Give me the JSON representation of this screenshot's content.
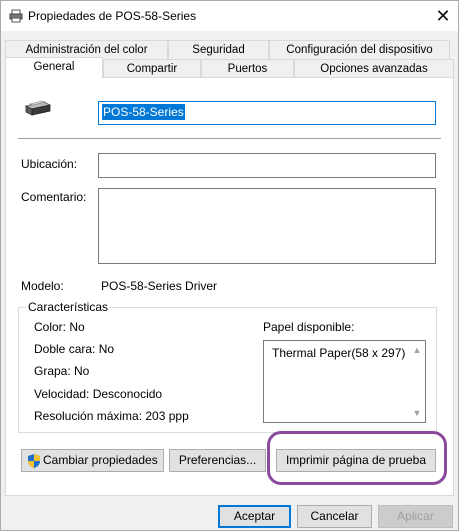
{
  "window": {
    "title": "Propiedades de POS-58-Series",
    "close_glyph": "✕"
  },
  "tabs": {
    "row_top": [
      "Administración del color",
      "Seguridad",
      "Configuración del dispositivo"
    ],
    "row_bottom": [
      "General",
      "Compartir",
      "Puertos",
      "Opciones avanzadas"
    ],
    "active": "General"
  },
  "general": {
    "printer_name": "POS-58-Series",
    "location_label": "Ubicación:",
    "location_value": "",
    "comment_label": "Comentario:",
    "comment_value": "",
    "model_label": "Modelo:",
    "model_value": "POS-58-Series Driver"
  },
  "features": {
    "group_label": "Características",
    "color": "Color: No",
    "duplex": "Doble cara: No",
    "staple": "Grapa: No",
    "speed": "Velocidad: Desconocido",
    "resolution": "Resolución máxima: 203 ppp",
    "paper_label": "Papel disponible:",
    "paper_items": [
      "Thermal Paper(58 x 297)"
    ]
  },
  "actions": {
    "change_properties": "Cambiar propiedades",
    "preferences": "Preferencias...",
    "print_test": "Imprimir página de prueba"
  },
  "footer": {
    "ok": "Aceptar",
    "cancel": "Cancelar",
    "apply": "Aplicar"
  },
  "colors": {
    "accent": "#0078d7",
    "highlight_ring": "#8b4a9c"
  },
  "icons": [
    "printer-icon",
    "close-icon",
    "printer-large-icon",
    "shield-icon",
    "scroll-up-icon",
    "scroll-down-icon"
  ]
}
